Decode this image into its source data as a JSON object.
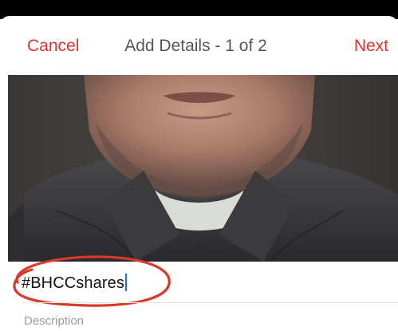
{
  "navbar": {
    "cancel_label": "Cancel",
    "title": "Add Details - 1 of 2",
    "next_label": "Next"
  },
  "form": {
    "tag_value": "#BHCCshares",
    "description_placeholder": "Description"
  },
  "colors": {
    "accent": "#e0322e",
    "cursor": "#1f6fe0",
    "annotation": "#d83a2a"
  }
}
